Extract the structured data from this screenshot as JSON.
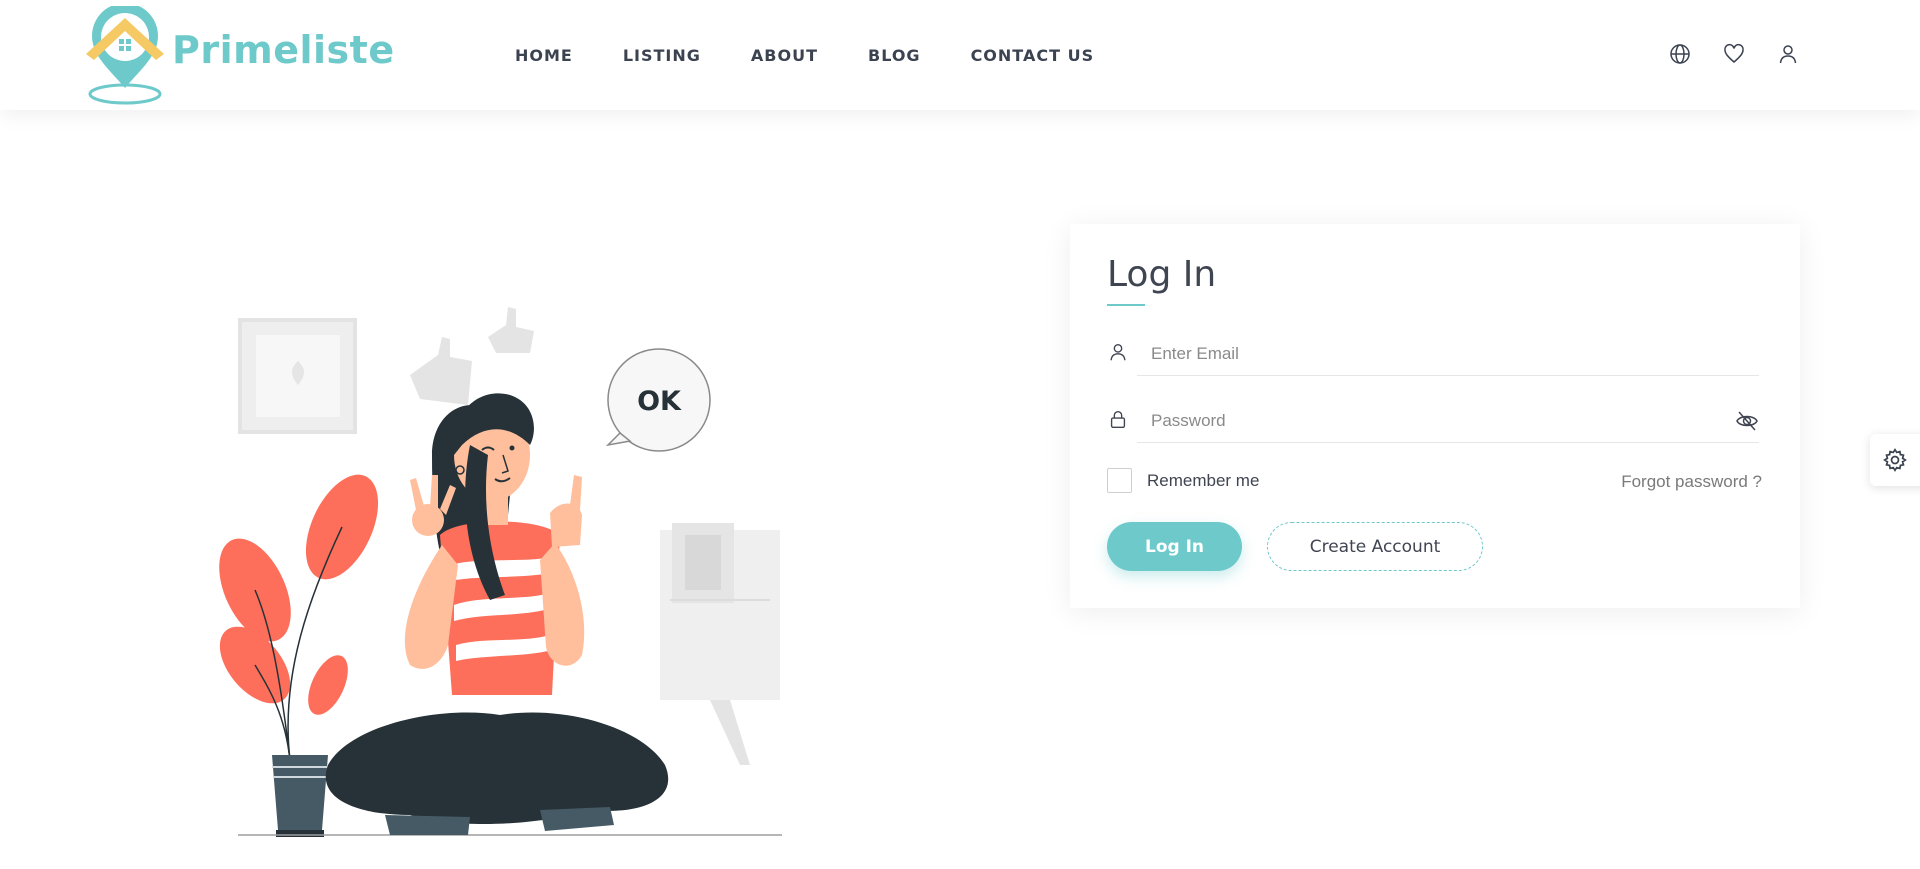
{
  "brand": {
    "name": "Primeliste",
    "accent": "#6ec9cb",
    "roof": "#f5c963"
  },
  "nav": {
    "items": [
      {
        "label": "HOME"
      },
      {
        "label": "LISTING"
      },
      {
        "label": "ABOUT"
      },
      {
        "label": "BLOG"
      },
      {
        "label": "CONTACT US"
      }
    ]
  },
  "header_icons": [
    "globe-icon",
    "heart-icon",
    "user-icon"
  ],
  "illustration": {
    "speech_bubble": "OK"
  },
  "login": {
    "title": "Log In",
    "email_placeholder": "Enter Email",
    "password_placeholder": "Password",
    "remember_label": "Remember me",
    "forgot_label": "Forgot password ?",
    "login_button": "Log In",
    "create_button": "Create Account"
  },
  "settings": {
    "icon": "gear-icon"
  }
}
